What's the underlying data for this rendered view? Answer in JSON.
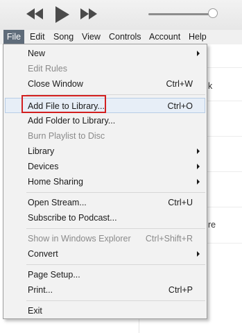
{
  "transport": {
    "prev_icon": "rewind-icon",
    "play_icon": "play-icon",
    "next_icon": "fast-forward-icon",
    "volume_level": 0.9
  },
  "menubar": {
    "items": [
      "File",
      "Edit",
      "Song",
      "View",
      "Controls",
      "Account",
      "Help"
    ],
    "active": "File"
  },
  "background": {
    "text_1": "k",
    "text_2": "re"
  },
  "file_menu": {
    "new": "New",
    "edit_rules": "Edit Rules",
    "close_window": "Close Window",
    "close_window_sc": "Ctrl+W",
    "add_file": "Add File to Library...",
    "add_file_sc": "Ctrl+O",
    "add_folder": "Add Folder to Library...",
    "burn_playlist": "Burn Playlist to Disc",
    "library": "Library",
    "devices": "Devices",
    "home_sharing": "Home Sharing",
    "open_stream": "Open Stream...",
    "open_stream_sc": "Ctrl+U",
    "subscribe_podcast": "Subscribe to Podcast...",
    "show_in_explorer": "Show in Windows Explorer",
    "show_in_explorer_sc": "Ctrl+Shift+R",
    "convert": "Convert",
    "page_setup": "Page Setup...",
    "print": "Print...",
    "print_sc": "Ctrl+P",
    "exit": "Exit"
  },
  "colors": {
    "highlight_border": "#d21f1f",
    "active_menu_bg": "#5f6c7a"
  }
}
